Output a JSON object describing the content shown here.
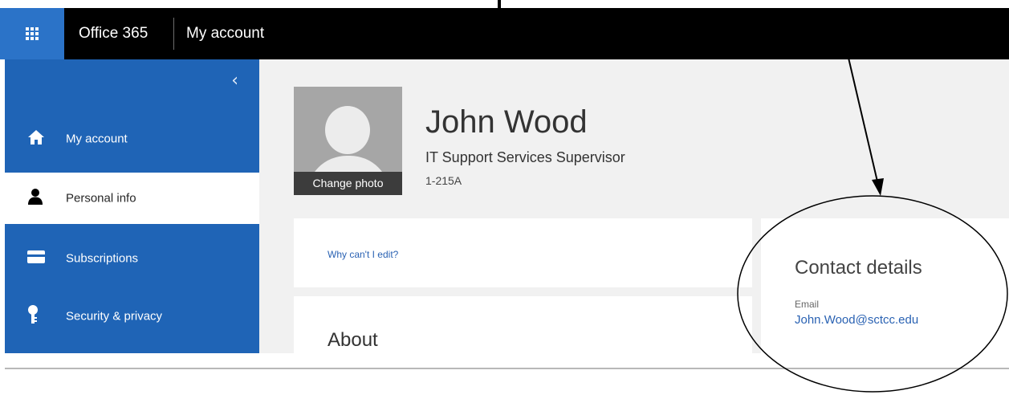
{
  "header": {
    "brand": "Office 365",
    "app_title": "My account"
  },
  "sidebar": {
    "collapse_icon": "chevron-left-icon",
    "items": [
      {
        "label": "My account",
        "icon": "home-icon",
        "active": false
      },
      {
        "label": "Personal info",
        "icon": "person-icon",
        "active": true
      },
      {
        "label": "Subscriptions",
        "icon": "card-icon",
        "active": false
      },
      {
        "label": "Security & privacy",
        "icon": "key-icon",
        "active": false
      }
    ]
  },
  "profile": {
    "name": "John Wood",
    "title": "IT Support Services Supervisor",
    "office": "1-215A",
    "change_photo": "Change photo"
  },
  "cards": {
    "why_edit": "Why can't I edit?",
    "about_title": "About"
  },
  "contact": {
    "title": "Contact details",
    "email_label": "Email",
    "email": "John.Wood@sctcc.edu"
  },
  "colors": {
    "accent": "#1f64b6",
    "link": "#2a62b3",
    "topbar": "#000000"
  }
}
